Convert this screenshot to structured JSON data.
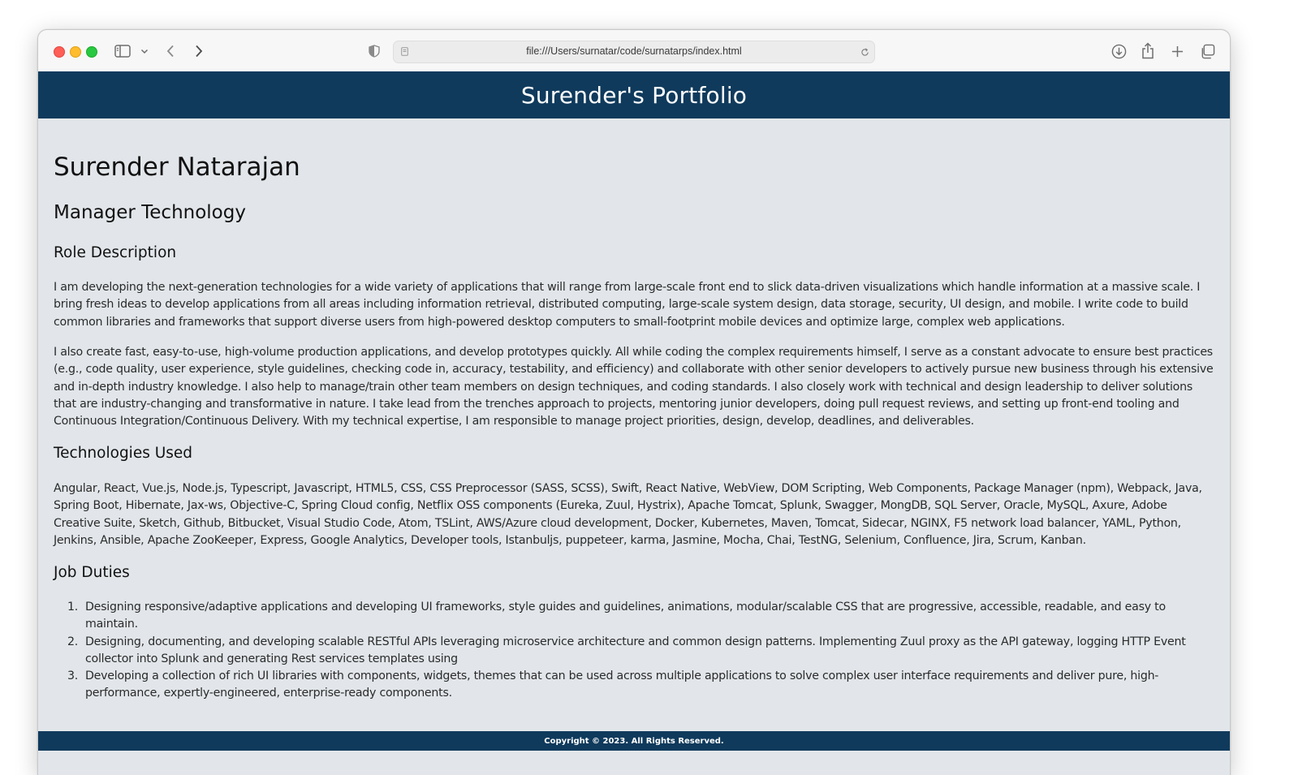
{
  "browser": {
    "url": "file:///Users/surnatar/code/surnatarps/index.html",
    "icons": {
      "sidebar": "sidebar-icon",
      "back": "chevron-left-icon",
      "forward": "chevron-right-icon",
      "privacy": "shield-icon",
      "page": "page-icon",
      "reload": "reload-icon",
      "download": "download-icon",
      "share": "share-icon",
      "new_tab": "plus-icon",
      "tabs": "tab-overview-icon"
    }
  },
  "header": {
    "title": "Surender's Portfolio",
    "background": "#0f3a5c"
  },
  "profile": {
    "name": "Surender Natarajan",
    "job_title": "Manager Technology"
  },
  "role": {
    "heading": "Role Description",
    "paragraphs": [
      "I am developing the next-generation technologies for a wide variety of applications that will range from large-scale front end to slick data-driven visualizations which handle information at a massive scale. I bring fresh ideas to develop applications from all areas including information retrieval, distributed computing, large-scale system design, data storage, security, UI design, and mobile. I write code to build common libraries and frameworks that support diverse users from high-powered desktop computers to small-footprint mobile devices and optimize large, complex web applications.",
      "I also create fast, easy-to-use, high-volume production applications, and develop prototypes quickly. All while coding the complex requirements himself, I serve as a constant advocate to ensure best practices (e.g., code quality, user experience, style guidelines, checking code in, accuracy, testability, and efficiency) and collaborate with other senior developers to actively pursue new business through his extensive and in-depth industry knowledge. I also help to manage/train other team members on design techniques, and coding standards. I also closely work with technical and design leadership to deliver solutions that are industry-changing and transformative in nature. I take lead from the trenches approach to projects, mentoring junior developers, doing pull request reviews, and setting up front-end tooling and Continuous Integration/Continuous Delivery. With my technical expertise, I am responsible to manage project priorities, design, develop, deadlines, and deliverables."
    ]
  },
  "technologies": {
    "heading": "Technologies Used",
    "text": "Angular, React, Vue.js, Node.js, Typescript, Javascript, HTML5, CSS, CSS Preprocessor (SASS, SCSS), Swift, React Native, WebView, DOM Scripting, Web Components, Package Manager (npm), Webpack, Java, Spring Boot, Hibernate, Jax-ws, Objective-C, Spring Cloud config, Netflix OSS components (Eureka, Zuul, Hystrix), Apache Tomcat, Splunk, Swagger, MongDB, SQL Server, Oracle, MySQL, Axure, Adobe Creative Suite, Sketch, Github, Bitbucket, Visual Studio Code, Atom, TSLint, AWS/Azure cloud development, Docker, Kubernetes, Maven, Tomcat, Sidecar, NGINX, F5 network load balancer, YAML, Python, Jenkins, Ansible, Apache ZooKeeper, Express, Google Analytics, Developer tools, Istanbuljs, puppeteer, karma, Jasmine, Mocha, Chai, TestNG, Selenium, Confluence, Jira, Scrum, Kanban."
  },
  "duties": {
    "heading": "Job Duties",
    "items": [
      {
        "num": "1.",
        "text": "Designing responsive/adaptive applications and developing UI frameworks, style guides and guidelines, animations, modular/scalable CSS that are progressive, accessible, readable, and easy to maintain."
      },
      {
        "num": "2.",
        "text": "Designing, documenting, and developing scalable RESTful APIs leveraging microservice architecture and common design patterns. Implementing Zuul proxy as the API gateway, logging HTTP Event collector into Splunk and generating Rest services templates using"
      },
      {
        "num": "3.",
        "text": "Developing a collection of rich UI libraries with components, widgets, themes that can be used across multiple applications to solve complex user interface requirements and deliver pure, high-performance, expertly-engineered, enterprise-ready components."
      }
    ]
  },
  "footer": {
    "text": "Copyright © 2023. All Rights Reserved."
  }
}
